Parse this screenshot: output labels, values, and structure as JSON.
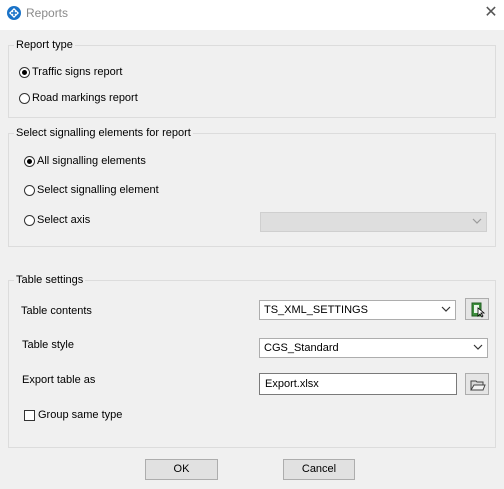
{
  "window": {
    "title": "Reports",
    "close_glyph": "✕"
  },
  "report_type": {
    "legend": "Report type",
    "options": [
      {
        "label": "Traffic signs report",
        "checked": true
      },
      {
        "label": "Road markings report",
        "checked": false
      }
    ]
  },
  "signalling": {
    "legend": "Select signalling elements for report",
    "options": [
      {
        "label": "All signalling elements",
        "checked": true
      },
      {
        "label": "Select signalling element",
        "checked": false
      },
      {
        "label": "Select axis",
        "checked": false
      }
    ],
    "axis_combo_value": ""
  },
  "table_settings": {
    "legend": "Table settings",
    "contents_label": "Table contents",
    "contents_value": "TS_XML_SETTINGS",
    "style_label": "Table style",
    "style_value": "CGS_Standard",
    "export_label": "Export table as",
    "export_value": "Export.xlsx",
    "group_label": "Group same type",
    "group_checked": false
  },
  "buttons": {
    "ok": "OK",
    "cancel": "Cancel"
  },
  "colors": {
    "accent": "#1a73c8",
    "disabled_combo": "#dedede"
  }
}
